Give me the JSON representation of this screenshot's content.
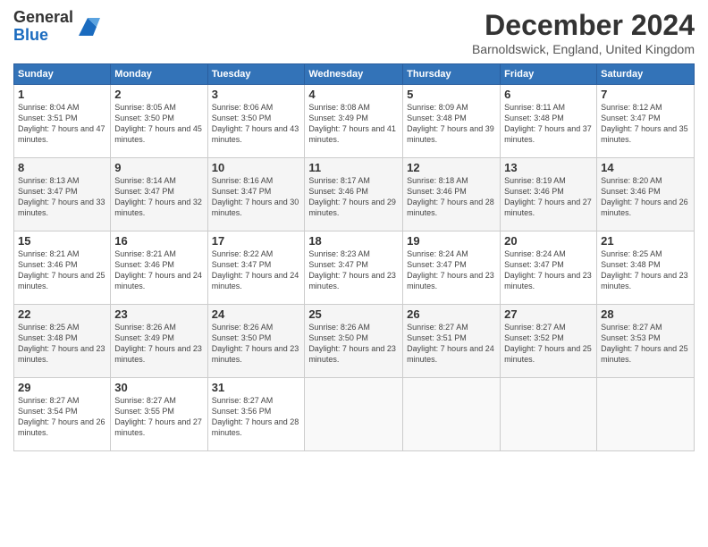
{
  "logo": {
    "general": "General",
    "blue": "Blue"
  },
  "title": "December 2024",
  "subtitle": "Barnoldswick, England, United Kingdom",
  "days_of_week": [
    "Sunday",
    "Monday",
    "Tuesday",
    "Wednesday",
    "Thursday",
    "Friday",
    "Saturday"
  ],
  "weeks": [
    [
      {
        "day": "1",
        "sunrise": "8:04 AM",
        "sunset": "3:51 PM",
        "daylight": "7 hours and 47 minutes."
      },
      {
        "day": "2",
        "sunrise": "8:05 AM",
        "sunset": "3:50 PM",
        "daylight": "7 hours and 45 minutes."
      },
      {
        "day": "3",
        "sunrise": "8:06 AM",
        "sunset": "3:50 PM",
        "daylight": "7 hours and 43 minutes."
      },
      {
        "day": "4",
        "sunrise": "8:08 AM",
        "sunset": "3:49 PM",
        "daylight": "7 hours and 41 minutes."
      },
      {
        "day": "5",
        "sunrise": "8:09 AM",
        "sunset": "3:48 PM",
        "daylight": "7 hours and 39 minutes."
      },
      {
        "day": "6",
        "sunrise": "8:11 AM",
        "sunset": "3:48 PM",
        "daylight": "7 hours and 37 minutes."
      },
      {
        "day": "7",
        "sunrise": "8:12 AM",
        "sunset": "3:47 PM",
        "daylight": "7 hours and 35 minutes."
      }
    ],
    [
      {
        "day": "8",
        "sunrise": "8:13 AM",
        "sunset": "3:47 PM",
        "daylight": "7 hours and 33 minutes."
      },
      {
        "day": "9",
        "sunrise": "8:14 AM",
        "sunset": "3:47 PM",
        "daylight": "7 hours and 32 minutes."
      },
      {
        "day": "10",
        "sunrise": "8:16 AM",
        "sunset": "3:47 PM",
        "daylight": "7 hours and 30 minutes."
      },
      {
        "day": "11",
        "sunrise": "8:17 AM",
        "sunset": "3:46 PM",
        "daylight": "7 hours and 29 minutes."
      },
      {
        "day": "12",
        "sunrise": "8:18 AM",
        "sunset": "3:46 PM",
        "daylight": "7 hours and 28 minutes."
      },
      {
        "day": "13",
        "sunrise": "8:19 AM",
        "sunset": "3:46 PM",
        "daylight": "7 hours and 27 minutes."
      },
      {
        "day": "14",
        "sunrise": "8:20 AM",
        "sunset": "3:46 PM",
        "daylight": "7 hours and 26 minutes."
      }
    ],
    [
      {
        "day": "15",
        "sunrise": "8:21 AM",
        "sunset": "3:46 PM",
        "daylight": "7 hours and 25 minutes."
      },
      {
        "day": "16",
        "sunrise": "8:21 AM",
        "sunset": "3:46 PM",
        "daylight": "7 hours and 24 minutes."
      },
      {
        "day": "17",
        "sunrise": "8:22 AM",
        "sunset": "3:47 PM",
        "daylight": "7 hours and 24 minutes."
      },
      {
        "day": "18",
        "sunrise": "8:23 AM",
        "sunset": "3:47 PM",
        "daylight": "7 hours and 23 minutes."
      },
      {
        "day": "19",
        "sunrise": "8:24 AM",
        "sunset": "3:47 PM",
        "daylight": "7 hours and 23 minutes."
      },
      {
        "day": "20",
        "sunrise": "8:24 AM",
        "sunset": "3:47 PM",
        "daylight": "7 hours and 23 minutes."
      },
      {
        "day": "21",
        "sunrise": "8:25 AM",
        "sunset": "3:48 PM",
        "daylight": "7 hours and 23 minutes."
      }
    ],
    [
      {
        "day": "22",
        "sunrise": "8:25 AM",
        "sunset": "3:48 PM",
        "daylight": "7 hours and 23 minutes."
      },
      {
        "day": "23",
        "sunrise": "8:26 AM",
        "sunset": "3:49 PM",
        "daylight": "7 hours and 23 minutes."
      },
      {
        "day": "24",
        "sunrise": "8:26 AM",
        "sunset": "3:50 PM",
        "daylight": "7 hours and 23 minutes."
      },
      {
        "day": "25",
        "sunrise": "8:26 AM",
        "sunset": "3:50 PM",
        "daylight": "7 hours and 23 minutes."
      },
      {
        "day": "26",
        "sunrise": "8:27 AM",
        "sunset": "3:51 PM",
        "daylight": "7 hours and 24 minutes."
      },
      {
        "day": "27",
        "sunrise": "8:27 AM",
        "sunset": "3:52 PM",
        "daylight": "7 hours and 25 minutes."
      },
      {
        "day": "28",
        "sunrise": "8:27 AM",
        "sunset": "3:53 PM",
        "daylight": "7 hours and 25 minutes."
      }
    ],
    [
      {
        "day": "29",
        "sunrise": "8:27 AM",
        "sunset": "3:54 PM",
        "daylight": "7 hours and 26 minutes."
      },
      {
        "day": "30",
        "sunrise": "8:27 AM",
        "sunset": "3:55 PM",
        "daylight": "7 hours and 27 minutes."
      },
      {
        "day": "31",
        "sunrise": "8:27 AM",
        "sunset": "3:56 PM",
        "daylight": "7 hours and 28 minutes."
      },
      null,
      null,
      null,
      null
    ]
  ],
  "labels": {
    "sunrise": "Sunrise:",
    "sunset": "Sunset:",
    "daylight": "Daylight:"
  }
}
